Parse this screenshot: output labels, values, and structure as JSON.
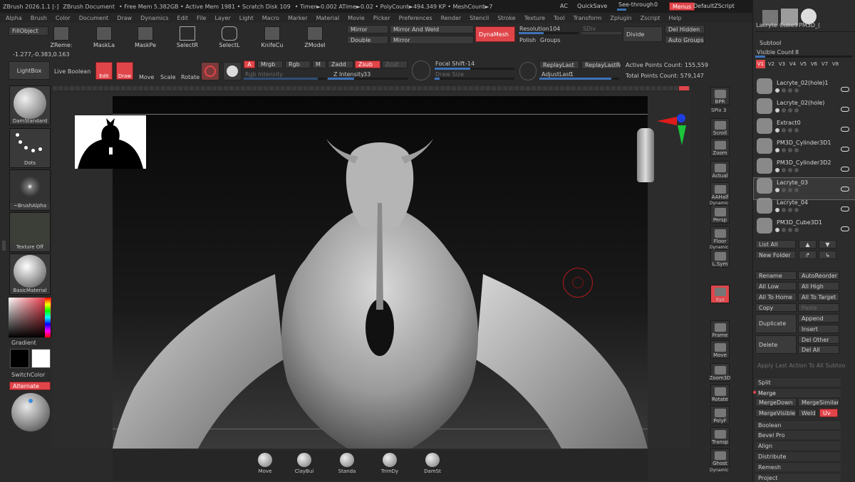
{
  "titlebar": {
    "app": "ZBrush 2026.1.1 [-]",
    "doc": "ZBrush Document",
    "mem": "• Free Mem 5.382GB • Active Mem 1981 • Scratch Disk 109",
    "timer": "• Timer►0.002 ATime►0.02 • PolyCount►494.349 KP • MeshCount►7",
    "ac": "AC",
    "quicksave": "QuickSave",
    "seethrough": "See-through",
    "seethrough_val": "0",
    "menus": "Menus",
    "script": "DefaultZScript"
  },
  "menubar": [
    "Alpha",
    "Brush",
    "Color",
    "Document",
    "Draw",
    "Dynamics",
    "Edit",
    "File",
    "Layer",
    "Light",
    "Macro",
    "Marker",
    "Material",
    "Movie",
    "Picker",
    "Preferences",
    "Render",
    "Stencil",
    "Stroke",
    "Texture",
    "Tool",
    "Transform",
    "Zplugin",
    "Zscript",
    "Help"
  ],
  "toolbar": {
    "fillobject": "FillObject",
    "coords": "-1.277,-0.383,0.163",
    "zremesh": "ZReme:",
    "maskla": "MaskLa",
    "maskpe": "MaskPe",
    "selectr": "SelectR",
    "selectl": "SelectL",
    "knifecu": "KnifeCu",
    "zmodel": "ZModel",
    "mirror": "Mirror",
    "mirrorweld": "Mirror And Weld",
    "double": "Double",
    "mirror2": "Mirror",
    "dynamesh": "DynaMesh",
    "resolution": "Resolution",
    "resolution_val": "104",
    "sdiv": "SDiv",
    "polish": "Polish",
    "groups": "Groups",
    "divide": "Divide",
    "delhidden": "Del Hidden",
    "autogroups": "Auto Groups"
  },
  "toolbar2": {
    "lightbox": "LightBox",
    "liveboolean": "Live Boolean",
    "edit": "Edit",
    "draw": "Draw",
    "move": "Move",
    "scale": "Scale",
    "rotate": "Rotate",
    "a": "A",
    "mrgb": "Mrgb",
    "rgb": "Rgb",
    "m": "M",
    "zadd": "Zadd",
    "zsub": "Zsub",
    "zcut": "Zcut",
    "rgbintensity": "Rgb Intensity",
    "zintensity": "Z Intensity",
    "zintensity_val": "33",
    "focalshift": "Focal Shift",
    "focalshift_val": "-14",
    "drawsize": "Draw Size",
    "replaylast": "ReplayLast",
    "replaylastrel": "ReplayLastRel",
    "adjustlast": "AdjustLast",
    "adjustlast_val": "1",
    "activepoints": "Active Points Count: 155,559",
    "totalpoints": "Total Points Count: 579,147"
  },
  "left": {
    "brush": "DamStandard",
    "stroke": "Dots",
    "alpha": "~BrushAlpha",
    "texture": "Texture Off",
    "material": "BasicMaterial",
    "gradient": "Gradient",
    "switchcolor": "SwitchColor",
    "alternate": "Alternate"
  },
  "bottom": [
    "Move",
    "ClayBui",
    "Standa",
    "TrimDy",
    "DamSt"
  ],
  "rightnav": [
    {
      "label": "BPR",
      "sub": "SPix 3"
    },
    {
      "label": "Scroll"
    },
    {
      "label": "Zoom"
    },
    {
      "label": "Actual"
    },
    {
      "label": "AAHalf"
    },
    {
      "label": "Persp"
    },
    {
      "label": "Floor"
    },
    {
      "label": "L.Sym"
    },
    {
      "label": "Xyz"
    },
    {
      "label": "Frame"
    },
    {
      "label": "Move"
    },
    {
      "label": "Zoom3D"
    },
    {
      "label": "Rotate"
    },
    {
      "label": "PolyF"
    },
    {
      "label": "Transp"
    },
    {
      "label": "Ghost"
    }
  ],
  "dynamic": "Dynamic",
  "subtool": {
    "toptools": [
      "Lacryte",
      "Cube3",
      "PM3D_("
    ],
    "title": "Subtool",
    "visible": "Visible Count",
    "visible_val": "8",
    "versions": [
      "V1",
      "V2",
      "V3",
      "V4",
      "V5",
      "V6",
      "V7",
      "V8"
    ],
    "items": [
      "Lacryte_02(hole)1",
      "Lacryte_02(hole)",
      "Extract0",
      "PM3D_Cylinder3D1",
      "PM3D_Cylinder3D2",
      "Lacryte_03",
      "Lacryte_04",
      "PM3D_Cube3D1"
    ],
    "listall": "List All",
    "newfolder": "New Folder",
    "rename": "Rename",
    "autoreorder": "AutoReorder",
    "alllow": "All Low",
    "allhigh": "All High",
    "alltohome": "All To Home",
    "alltotarget": "All To Target",
    "copy": "Copy",
    "paste": "Paste",
    "duplicate": "Duplicate",
    "append": "Append",
    "insert": "Insert",
    "delete": "Delete",
    "delother": "Del Other",
    "delall": "Del All",
    "applylast": "Apply Last Action To All Subtoo",
    "split": "Split",
    "merge": "Merge",
    "mergedown": "MergeDown",
    "mergesimilar": "MergeSimilar",
    "mergevisible": "MergeVisible",
    "weld": "Weld",
    "uv": "Uv",
    "boolean": "Boolean",
    "bevelpro": "Bevel Pro",
    "align": "Align",
    "distribute": "Distribute",
    "remesh": "Remesh",
    "project": "Project"
  }
}
